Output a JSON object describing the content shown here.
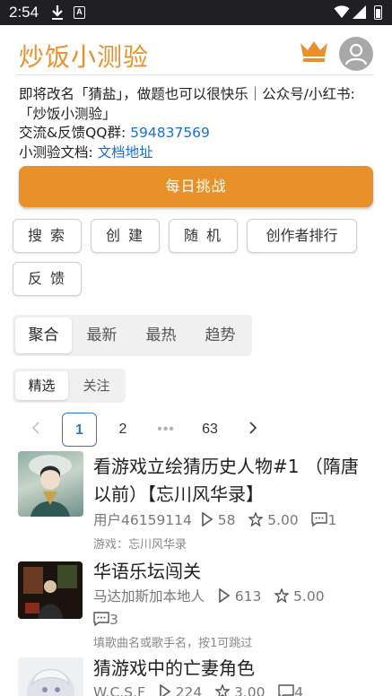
{
  "status_bar": {
    "time": "2:54",
    "a_badge": "A"
  },
  "header": {
    "title": "炒饭小测验"
  },
  "info": {
    "line1": "即将改名「猜盐」，做题也可以很快乐｜公众号/小红书:「炒饭小测验」",
    "qq_label": "交流&反馈QQ群:",
    "qq_value": "594837569",
    "doc_label": "小测验文档:",
    "doc_link": "文档地址"
  },
  "daily_button": "每日挑战",
  "actions": {
    "search": "搜 索",
    "create": "创 建",
    "random": "随 机",
    "ranking": "创作者排行",
    "feedback": "反 馈"
  },
  "main_tabs": [
    "聚合",
    "最新",
    "最热",
    "趋势"
  ],
  "sub_tabs": [
    "精选",
    "关注"
  ],
  "pagination": {
    "current": "1",
    "next": "2",
    "dots": "•••",
    "last": "63"
  },
  "quizzes": [
    {
      "title": "看游戏立绘猜历史人物#1 （隋唐以前）【忘川风华录】",
      "author": "用户46159114",
      "plays": "58",
      "rating": "5.00",
      "comments": "1",
      "desc": "游戏：忘川风华录"
    },
    {
      "title": "华语乐坛闯关",
      "author": "马达加斯加本地人",
      "plays": "613",
      "rating": "5.00",
      "comments": "3",
      "desc": "填歌曲名或歌手名，按1可跳过"
    },
    {
      "title": "猜游戏中的亡妻角色",
      "author": "W.C.S.F",
      "plays": "224",
      "rating": "3.00",
      "comments": "4",
      "desc": ""
    }
  ],
  "colors": {
    "accent": "#e8902a",
    "link": "#1a6fd0",
    "status_bar": "#1f1f24"
  }
}
